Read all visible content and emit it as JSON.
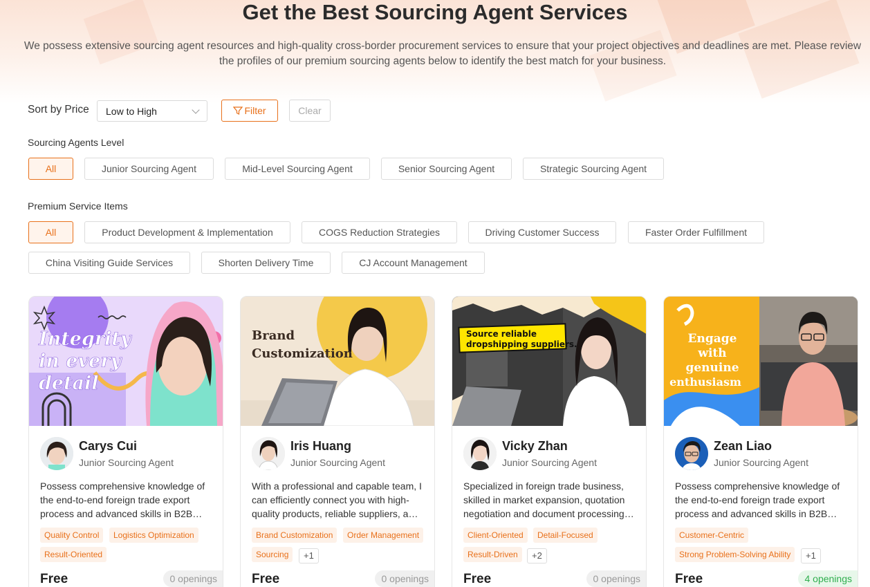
{
  "header": {
    "title": "Get the Best Sourcing Agent Services",
    "description": "We possess extensive sourcing agent resources and high-quality cross-border procurement services to ensure that your project objectives and deadlines are met. Please review the profiles of our premium sourcing agents below to identify the best match for your business."
  },
  "sort": {
    "label": "Sort by Price",
    "selected": "Low to High"
  },
  "filter": {
    "filter_label": "Filter",
    "clear_label": "Clear"
  },
  "levels": {
    "label": "Sourcing Agents Level",
    "items": [
      "All",
      "Junior Sourcing Agent",
      "Mid-Level Sourcing Agent",
      "Senior Sourcing Agent",
      "Strategic Sourcing Agent"
    ],
    "active": "All"
  },
  "services": {
    "label": "Premium Service Items",
    "items": [
      "All",
      "Product Development & Implementation",
      "COGS Reduction Strategies",
      "Driving Customer Success",
      "Faster Order Fulfillment",
      "China Visiting Guide Services",
      "Shorten Delivery Time",
      "CJ Account Management"
    ],
    "active": "All"
  },
  "agents": [
    {
      "name": "Carys Cui",
      "level": "Junior Sourcing Agent",
      "description": "Possess comprehensive knowledge of the end-to-end foreign trade export process and advanced skills in B2B…",
      "banner_text": [
        "Integrity",
        "in every",
        "detail"
      ],
      "tags": [
        "Quality Control",
        "Logistics Optimization",
        "Result-Oriented"
      ],
      "more": "",
      "price": "Free",
      "openings": "0 openings"
    },
    {
      "name": "Iris Huang",
      "level": "Junior Sourcing Agent",
      "description": "With a professional and capable team, I can efficiently connect you with high-quality products, reliable suppliers, a…",
      "banner_text": [
        "Brand",
        "Customization"
      ],
      "tags": [
        "Brand Customization",
        "Order Management",
        "Sourcing"
      ],
      "more": "+1",
      "price": "Free",
      "openings": "0 openings"
    },
    {
      "name": "Vicky Zhan",
      "level": "Junior Sourcing Agent",
      "description": "Specialized in foreign trade business, skilled in market expansion, quotation negotiation and document processing…",
      "banner_text": [
        "Source reliable",
        "dropshipping suppliers."
      ],
      "tags": [
        "Client-Oriented",
        "Detail-Focused",
        "Result-Driven"
      ],
      "more": "+2",
      "price": "Free",
      "openings": "0 openings"
    },
    {
      "name": "Zean Liao",
      "level": "Junior Sourcing Agent",
      "description": "Possess comprehensive knowledge of the end-to-end foreign trade export process and advanced skills in B2B…",
      "banner_text": [
        "Engage",
        "with",
        "genuine",
        "enthusiasm"
      ],
      "tags": [
        "Customer-Centric",
        "Strong Problem-Solving Ability"
      ],
      "more": "+1",
      "price": "Free",
      "openings": "4 openings"
    }
  ],
  "colors": {
    "accent": "#e8701a",
    "open_green": "#2fae4e"
  }
}
